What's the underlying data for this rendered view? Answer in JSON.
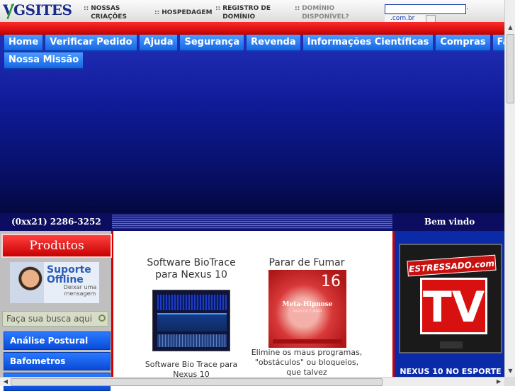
{
  "header": {
    "logo": "VGSITES",
    "separator": "::",
    "topnav": [
      {
        "line1": "NOSSAS",
        "line2": "CRIAÇÕES"
      },
      {
        "line1": "HOSPEDAGEM",
        "line2": ""
      },
      {
        "line1": "REGISTRO DE",
        "line2": "DOMÍNIO"
      },
      {
        "line1": "DOMÍNIO",
        "line2": "DISPONÍVEL?"
      }
    ],
    "domain_input_value": "",
    "tld_value": ".com.br"
  },
  "menu": {
    "items": [
      "Home",
      "Verificar Pedido",
      "Ajuda",
      "Segurança",
      "Revenda",
      "Informações Científicas",
      "Compras",
      "Fale"
    ],
    "second_row": "Nossa Missão"
  },
  "phonebar": {
    "phone": "(0xx21) 2286-3252",
    "welcome": "Bem vindo"
  },
  "left": {
    "title": "Produtos",
    "support_line1": "Suporte",
    "support_line2": "Offline",
    "support_sub": "Deixar uma mensagem",
    "search_placeholder": "Faça sua busca aqui",
    "categories": [
      "Análise Postural",
      "Bafometros"
    ]
  },
  "center": {
    "products": [
      {
        "title": "Software BioTrace para Nexus 10",
        "desc": "Software Bio Trace para Nexus 10"
      },
      {
        "title": "Parar de Fumar",
        "image_number": "16",
        "image_label": "Meta-Hipnose",
        "image_sub": "PARA DE FUMAR",
        "desc": "Elimine os maus programas, \"obstáculos\" ou bloqueios, que talvez"
      }
    ]
  },
  "right": {
    "brand": "ESTRESSADO.com",
    "tv": "TV",
    "caption": "NEXUS 10 NO ESPORTE"
  },
  "colors": {
    "accent_red": "#d40000",
    "menu_blue": "#1566e6",
    "banner_blue": "#0f1a96",
    "phonebar": "#0c0c60"
  }
}
